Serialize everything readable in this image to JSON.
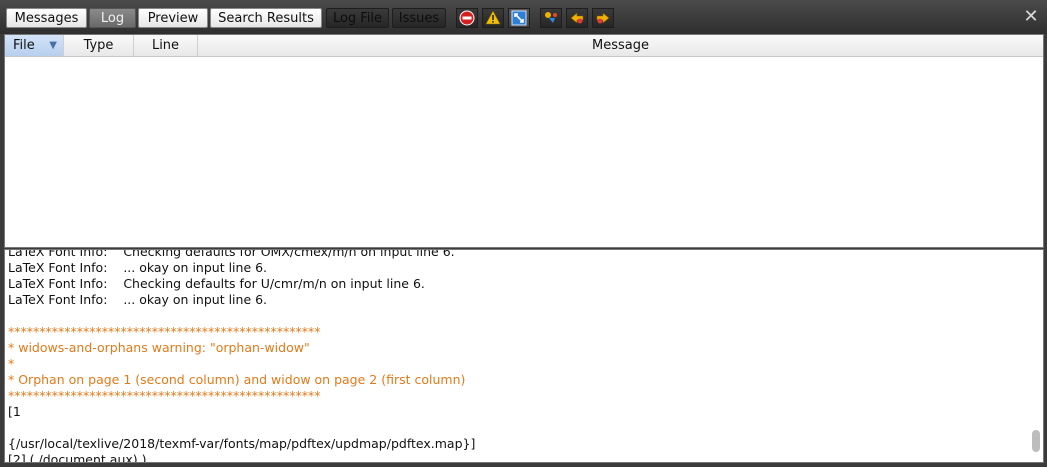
{
  "tabs": [
    {
      "label": "Messages",
      "state": "light"
    },
    {
      "label": "Log",
      "state": "selected"
    },
    {
      "label": "Preview",
      "state": "light"
    },
    {
      "label": "Search Results",
      "state": "light"
    },
    {
      "label": "Log File",
      "state": "dark"
    },
    {
      "label": "Issues",
      "state": "dark"
    }
  ],
  "toolbar_icons": [
    "error-filter-icon",
    "warning-filter-icon",
    "badbox-filter-icon",
    "run-icon",
    "previous-issue-icon",
    "next-issue-icon"
  ],
  "close_glyph": "✕",
  "table": {
    "columns": [
      "File",
      "Type",
      "Line",
      "Message"
    ],
    "sort_indicator": "▼"
  },
  "log": {
    "lines": [
      {
        "text": "LaTeX Font Info:    Checking defaults for OMX/cmex/m/n on input line 6.",
        "style": "normal"
      },
      {
        "text": "LaTeX Font Info:    ... okay on input line 6.",
        "style": "normal"
      },
      {
        "text": "LaTeX Font Info:    Checking defaults for U/cmr/m/n on input line 6.",
        "style": "normal"
      },
      {
        "text": "LaTeX Font Info:    ... okay on input line 6.",
        "style": "normal"
      },
      {
        "text": "",
        "style": "normal"
      },
      {
        "text": "**************************************************",
        "style": "orange"
      },
      {
        "text": "* widows-and-orphans warning: \"orphan-widow\"",
        "style": "orange"
      },
      {
        "text": "*",
        "style": "orange"
      },
      {
        "text": "* Orphan on page 1 (second column) and widow on page 2 (first column)",
        "style": "orange"
      },
      {
        "text": "**************************************************",
        "style": "orange"
      },
      {
        "text": "[1",
        "style": "normal"
      },
      {
        "text": "",
        "style": "normal"
      },
      {
        "text": "{/usr/local/texlive/2018/texmf-var/fonts/map/pdftex/updmap/pdftex.map}]",
        "style": "normal"
      },
      {
        "text": "[2] (./document.aux) )",
        "style": "normal"
      }
    ]
  },
  "colors": {
    "warning_text": "#e07a1a",
    "toolbar_bg": "#3b3b3b",
    "file_header_selected": "#c4d8f2"
  }
}
